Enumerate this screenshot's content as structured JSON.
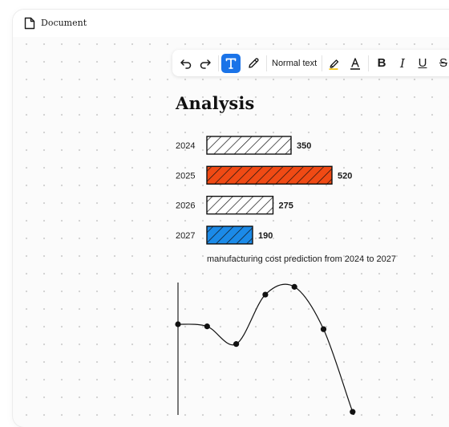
{
  "window": {
    "title": "Document"
  },
  "toolbar": {
    "buttons": [
      "undo-icon",
      "redo-icon",
      "text-icon",
      "pen-icon",
      "highlighter-icon",
      "font-color-icon"
    ],
    "text_style": "Normal text",
    "format": {
      "bold": "B",
      "italic": "I",
      "underline": "U",
      "strike": "S"
    },
    "accent_color": "#1a73e8"
  },
  "document": {
    "heading": "Analysis",
    "caption": "manufacturing cost prediction from 2024 to 2027"
  },
  "chart_data": [
    {
      "type": "bar",
      "orientation": "horizontal",
      "categories": [
        "2024",
        "2025",
        "2026",
        "2027"
      ],
      "values": [
        350,
        520,
        275,
        190
      ],
      "value_labels": [
        "350",
        "520",
        "275",
        "190"
      ],
      "colors": [
        "#ffffff",
        "#f04a14",
        "#ffffff",
        "#1b8ae8"
      ],
      "pattern": "diagonal-hatch",
      "title": "",
      "xlabel": "",
      "ylabel": ""
    },
    {
      "type": "line",
      "smooth": true,
      "markers": true,
      "x": [
        0,
        1,
        2,
        3,
        4,
        5,
        6
      ],
      "y": [
        10,
        9.7,
        7.2,
        14.2,
        15.3,
        9.3,
        -2.4
      ],
      "title": "",
      "xlabel": "",
      "ylabel": ""
    }
  ]
}
